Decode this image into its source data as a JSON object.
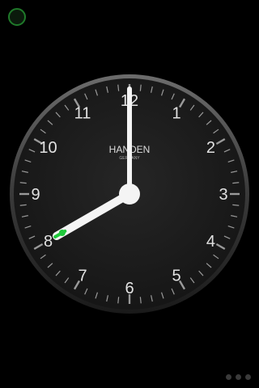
{
  "clock": {
    "brand": "HANDEN",
    "sub_brand": "GERMANY",
    "numerals": [
      "12",
      "1",
      "2",
      "3",
      "4",
      "5",
      "6",
      "7",
      "8",
      "9",
      "10",
      "11"
    ],
    "time": {
      "hour": 8,
      "minute": 0,
      "second": 0
    },
    "second_hand_color": "#1ec83a",
    "face_color": "#1f1f1f",
    "bezel_color": "#5a5a5a"
  },
  "status": {
    "ring_color": "#1f7a2a"
  },
  "pager": {
    "count": 3
  }
}
